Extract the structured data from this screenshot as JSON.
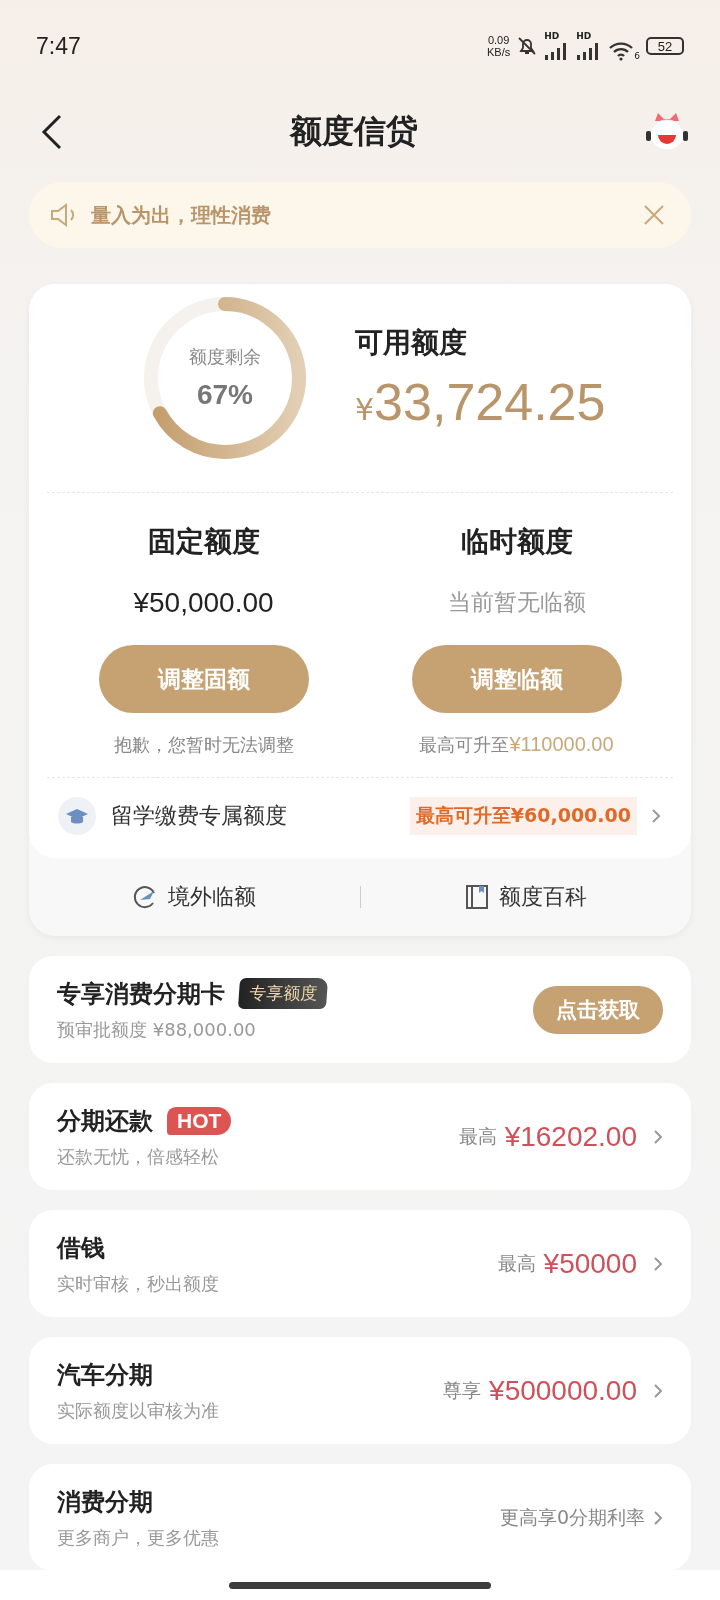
{
  "status_bar": {
    "time": "7:47",
    "net_speed": "0.09",
    "net_unit": "KB/s",
    "signal_labels": [
      "HD",
      "HD"
    ],
    "wifi_label": "6",
    "battery": "52"
  },
  "header": {
    "title": "额度信贷"
  },
  "notice": {
    "text": "量入为出，理性消费"
  },
  "quota": {
    "ring_label": "额度剩余",
    "ring_value": "67%",
    "available_label": "可用额度",
    "currency": "¥",
    "available_amount": "33,724.25",
    "columns": [
      {
        "title": "固定额度",
        "value": "¥50,000.00",
        "kind": "amount",
        "button": "调整固额",
        "note": "抱歉，您暂时无法调整"
      },
      {
        "title": "临时额度",
        "value": "当前暂无临额",
        "kind": "empty",
        "button": "调整临额",
        "note": "最高可升至",
        "note_amount": "¥110000.00"
      }
    ],
    "study": {
      "label": "留学缴费专属额度",
      "tag": "最高可升至¥60,000.00"
    },
    "links": [
      {
        "label": "境外临额",
        "kind": "plane"
      },
      {
        "label": "额度百科",
        "kind": "book"
      }
    ]
  },
  "card_offer": {
    "title": "专享消费分期卡",
    "badge": "专享额度",
    "subtitle": "预审批额度 ¥88,000.00",
    "button": "点击获取"
  },
  "products": [
    {
      "title": "分期还款",
      "badge": "HOT",
      "subtitle": "还款无忧，倍感轻松",
      "prefix": "最高",
      "amount": "¥16202.00"
    },
    {
      "title": "借钱",
      "subtitle": "实时审核，秒出额度",
      "prefix": "最高",
      "amount": "¥50000"
    },
    {
      "title": "汽车分期",
      "subtitle": "实际额度以审核为准",
      "prefix": "尊享",
      "amount": "¥500000.00"
    },
    {
      "title": "消费分期",
      "subtitle": "更多商户，更多优惠",
      "prefix": "更高享0分期利率"
    }
  ]
}
